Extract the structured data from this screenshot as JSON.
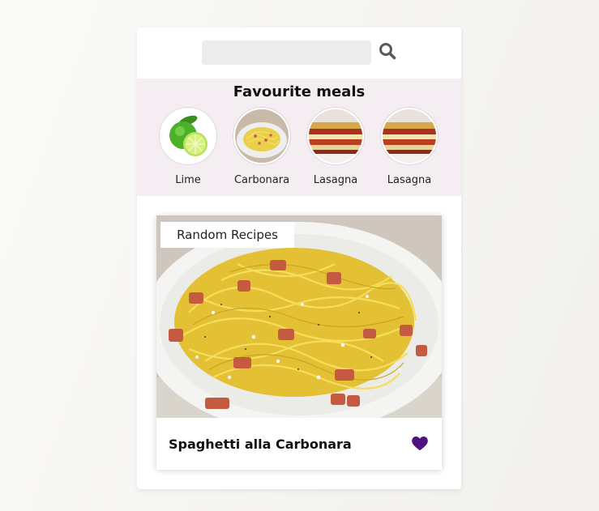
{
  "search": {
    "value": "",
    "placeholder": "",
    "icon": "search-icon"
  },
  "favourites": {
    "title": "Favourite meals",
    "items": [
      {
        "label": "Lime"
      },
      {
        "label": "Carbonara"
      },
      {
        "label": "Lasagna"
      },
      {
        "label": "Lasagna"
      }
    ]
  },
  "meal": {
    "tag": "Random Recipes",
    "name": "Spaghetti alla Carbonara",
    "favourite": true,
    "favourite_icon": "heart-icon"
  },
  "colors": {
    "accent": "#4f1280",
    "fav_band": "#f4eef2",
    "search_bg": "#ececec"
  }
}
